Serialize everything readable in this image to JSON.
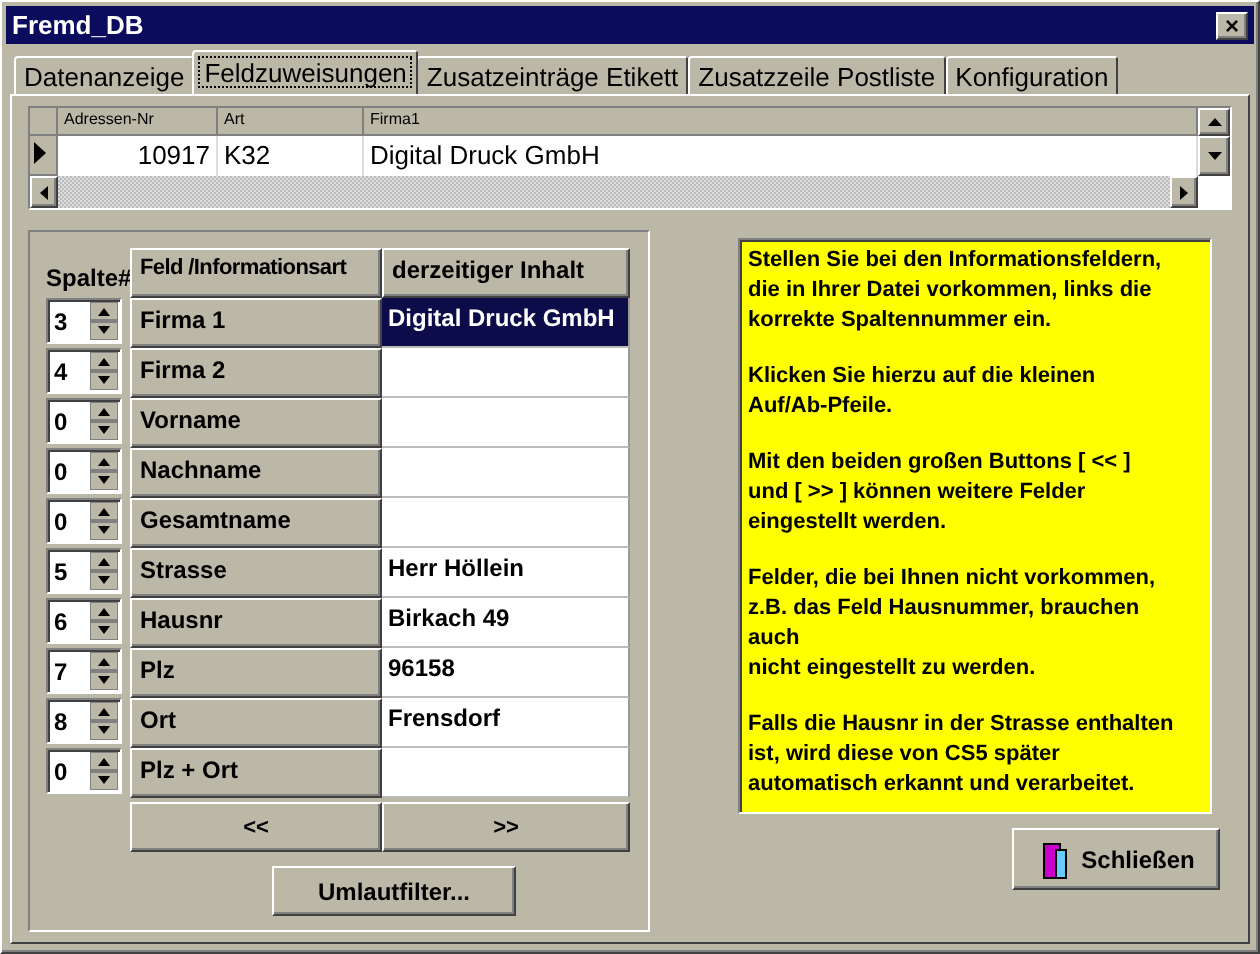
{
  "window": {
    "title": "Fremd_DB",
    "close": "×"
  },
  "tabs": [
    {
      "label": "Datenanzeige",
      "selected": false
    },
    {
      "label": "Feldzuweisungen",
      "selected": true
    },
    {
      "label": "Zusatzeinträge Etikett",
      "selected": false
    },
    {
      "label": "Zusatzzeile Postliste",
      "selected": false
    },
    {
      "label": "Konfiguration",
      "selected": false
    }
  ],
  "grid": {
    "columns": [
      "Adressen-Nr",
      "Art",
      "Firma1"
    ],
    "rows": [
      {
        "cells": [
          "10917",
          "K32",
          "Digital Druck GmbH"
        ],
        "current": true
      }
    ]
  },
  "mapping": {
    "headers": [
      "Spalte#",
      "Feld /Informationsart",
      "derzeitiger Inhalt"
    ],
    "rows": [
      {
        "column": "3",
        "field": "Firma 1",
        "content": "Digital Druck GmbH",
        "selected": true
      },
      {
        "column": "4",
        "field": "Firma 2",
        "content": "",
        "selected": false
      },
      {
        "column": "0",
        "field": "Vorname",
        "content": "",
        "selected": false
      },
      {
        "column": "0",
        "field": "Nachname",
        "content": "",
        "selected": false
      },
      {
        "column": "0",
        "field": "Gesamtname",
        "content": "",
        "selected": false
      },
      {
        "column": "5",
        "field": "Strasse",
        "content": "Herr Höllein",
        "selected": false
      },
      {
        "column": "6",
        "field": "Hausnr",
        "content": "Birkach 49",
        "selected": false
      },
      {
        "column": "7",
        "field": "Plz",
        "content": "96158",
        "selected": false
      },
      {
        "column": "8",
        "field": "Ort",
        "content": "Frensdorf",
        "selected": false
      },
      {
        "column": "0",
        "field": "Plz + Ort",
        "content": "",
        "selected": false
      }
    ],
    "prev_button": "<<",
    "next_button": ">>",
    "filter_button": "Umlautfilter..."
  },
  "help": [
    "Stellen Sie bei den Informationsfeldern,\ndie in Ihrer Datei vorkommen, links die\nkorrekte Spaltennummer ein.",
    "Klicken Sie hierzu auf die kleinen\nAuf/Ab-Pfeile.",
    "Mit den beiden großen Buttons [ << ]\nund [ >> ] können weitere Felder\neingestellt werden.",
    "Felder, die bei Ihnen nicht vorkommen,\nz.B. das Feld Hausnummer, brauchen\nauch\nnicht eingestellt zu werden.",
    "Falls die Hausnr in der Strasse enthalten\nist, wird diese von CS5 später\nautomatisch erkannt und verarbeitet."
  ],
  "close_button": "Schließen"
}
